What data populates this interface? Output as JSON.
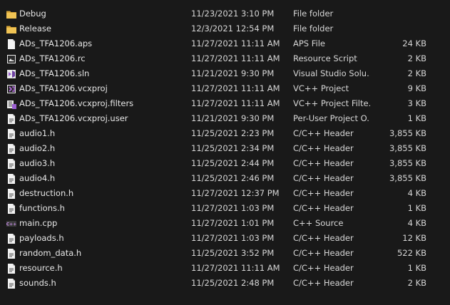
{
  "files": [
    {
      "name": "Debug",
      "date": "11/23/2021 3:10 PM",
      "type": "File folder",
      "size": "",
      "icon": "folder-icon"
    },
    {
      "name": "Release",
      "date": "12/3/2021 12:54 PM",
      "type": "File folder",
      "size": "",
      "icon": "folder-icon"
    },
    {
      "name": "ADs_TFA1206.aps",
      "date": "11/27/2021 11:11 AM",
      "type": "APS File",
      "size": "24 KB",
      "icon": "blank-file-icon"
    },
    {
      "name": "ADs_TFA1206.rc",
      "date": "11/27/2021 11:11 AM",
      "type": "Resource Script",
      "size": "2 KB",
      "icon": "resource-script-icon"
    },
    {
      "name": "ADs_TFA1206.sln",
      "date": "11/21/2021 9:30 PM",
      "type": "Visual Studio Solu...",
      "size": "2 KB",
      "icon": "visual-studio-solution-icon"
    },
    {
      "name": "ADs_TFA1206.vcxproj",
      "date": "11/27/2021 11:11 AM",
      "type": "VC++ Project",
      "size": "9 KB",
      "icon": "vcxproj-icon"
    },
    {
      "name": "ADs_TFA1206.vcxproj.filters",
      "date": "11/27/2021 11:11 AM",
      "type": "VC++ Project Filte...",
      "size": "3 KB",
      "icon": "vcxproj-filters-icon"
    },
    {
      "name": "ADs_TFA1206.vcxproj.user",
      "date": "11/21/2021 9:30 PM",
      "type": "Per-User Project O...",
      "size": "1 KB",
      "icon": "header-file-icon"
    },
    {
      "name": "audio1.h",
      "date": "11/25/2021 2:23 PM",
      "type": "C/C++ Header",
      "size": "3,855 KB",
      "icon": "header-file-icon"
    },
    {
      "name": "audio2.h",
      "date": "11/25/2021 2:34 PM",
      "type": "C/C++ Header",
      "size": "3,855 KB",
      "icon": "header-file-icon"
    },
    {
      "name": "audio3.h",
      "date": "11/25/2021 2:44 PM",
      "type": "C/C++ Header",
      "size": "3,855 KB",
      "icon": "header-file-icon"
    },
    {
      "name": "audio4.h",
      "date": "11/25/2021 2:46 PM",
      "type": "C/C++ Header",
      "size": "3,855 KB",
      "icon": "header-file-icon"
    },
    {
      "name": "destruction.h",
      "date": "11/27/2021 12:37 PM",
      "type": "C/C++ Header",
      "size": "4 KB",
      "icon": "header-file-icon"
    },
    {
      "name": "functions.h",
      "date": "11/27/2021 1:03 PM",
      "type": "C/C++ Header",
      "size": "1 KB",
      "icon": "header-file-icon"
    },
    {
      "name": "main.cpp",
      "date": "11/27/2021 1:01 PM",
      "type": "C++ Source",
      "size": "4 KB",
      "icon": "cpp-source-icon"
    },
    {
      "name": "payloads.h",
      "date": "11/27/2021 1:03 PM",
      "type": "C/C++ Header",
      "size": "12 KB",
      "icon": "header-file-icon"
    },
    {
      "name": "random_data.h",
      "date": "11/25/2021 3:52 PM",
      "type": "C/C++ Header",
      "size": "522 KB",
      "icon": "header-file-icon"
    },
    {
      "name": "resource.h",
      "date": "11/27/2021 11:11 AM",
      "type": "C/C++ Header",
      "size": "1 KB",
      "icon": "header-file-icon"
    },
    {
      "name": "sounds.h",
      "date": "11/25/2021 2:48 PM",
      "type": "C/C++ Header",
      "size": "2 KB",
      "icon": "header-file-icon"
    }
  ],
  "colors": {
    "background": "#191919",
    "text": "#e6e6e6",
    "folder": "#e8b94a",
    "vs_purple": "#9b5fd1",
    "cpp_purple": "#b46be0"
  }
}
